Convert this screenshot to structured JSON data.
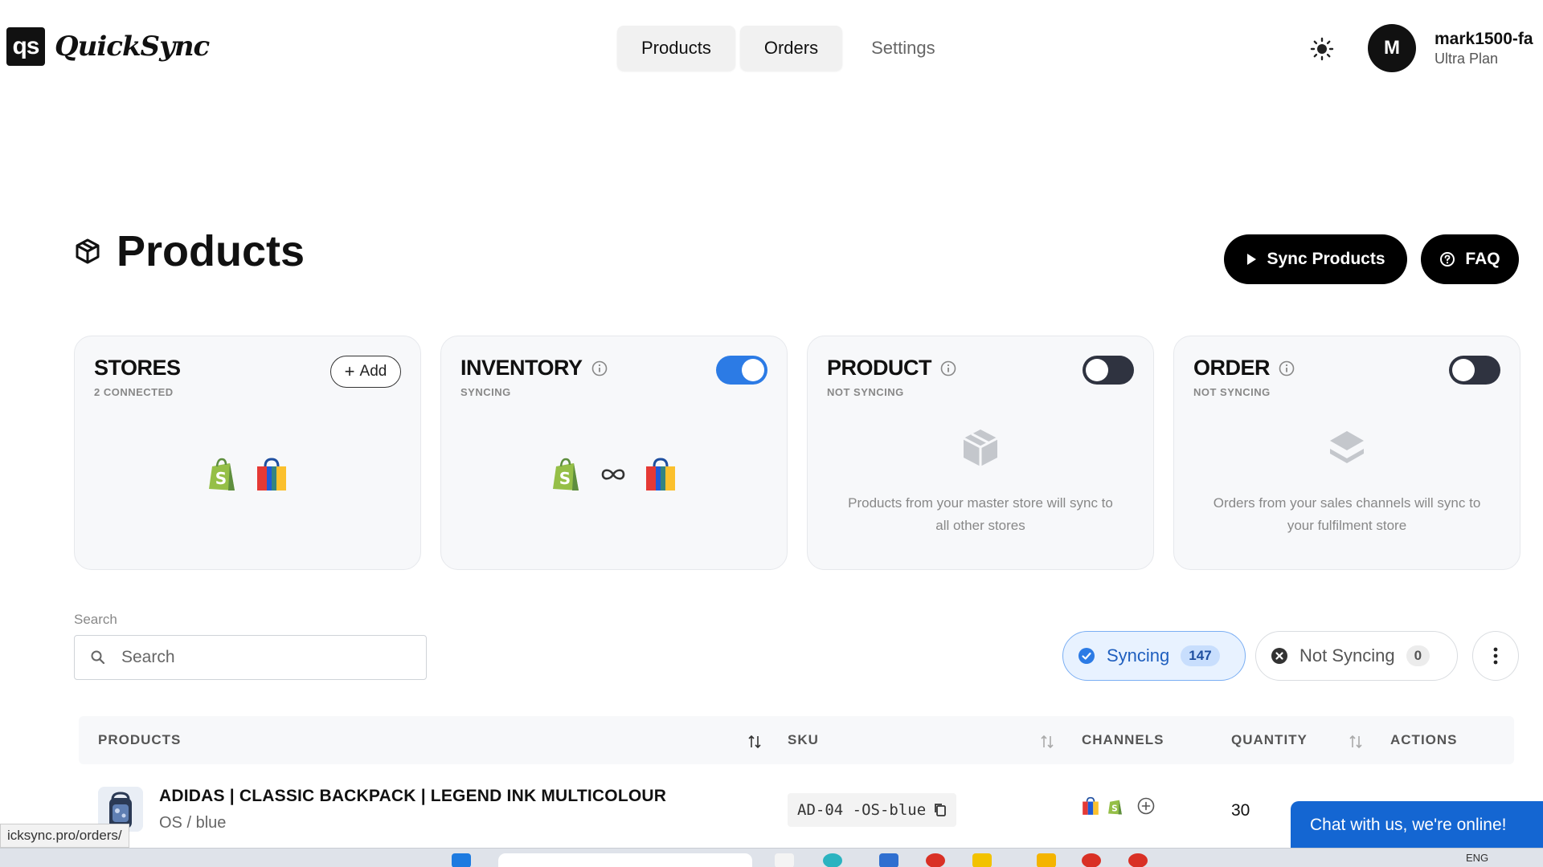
{
  "app": {
    "logo_mark": "qs",
    "logo_text": "QuickSync"
  },
  "nav": {
    "items": [
      {
        "label": "Products"
      },
      {
        "label": "Orders"
      },
      {
        "label": "Settings"
      }
    ]
  },
  "user": {
    "initial": "M",
    "name": "mark1500-fa",
    "plan": "Ultra Plan"
  },
  "page": {
    "title": "Products",
    "sync_button": "Sync Products",
    "faq_button": "FAQ"
  },
  "cards": {
    "stores": {
      "title": "STORES",
      "subtitle": "2 CONNECTED",
      "add_label": "Add"
    },
    "inventory": {
      "title": "INVENTORY",
      "subtitle": "SYNCING",
      "toggle_on": true
    },
    "product": {
      "title": "PRODUCT",
      "subtitle": "NOT SYNCING",
      "toggle_on": false,
      "description": "Products from your master store will sync to all other stores"
    },
    "order": {
      "title": "ORDER",
      "subtitle": "NOT SYNCING",
      "toggle_on": false,
      "description": "Orders from your sales channels will sync to your fulfilment store"
    }
  },
  "search": {
    "label": "Search",
    "placeholder": "Search",
    "value": ""
  },
  "filters": {
    "syncing": {
      "label": "Syncing",
      "count": "147"
    },
    "not_syncing": {
      "label": "Not Syncing",
      "count": "0"
    }
  },
  "table": {
    "headers": {
      "products": "PRODUCTS",
      "sku": "SKU",
      "channels": "CHANNELS",
      "quantity": "QUANTITY",
      "actions": "ACTIONS"
    },
    "rows": [
      {
        "name": "ADIDAS | CLASSIC BACKPACK | LEGEND INK MULTICOLOUR",
        "variant": "OS / blue",
        "sku": "AD-04 -OS-blue",
        "quantity": "30"
      }
    ]
  },
  "chat": {
    "label": "Chat with us, we're online!"
  },
  "status": {
    "url": "icksync.pro/orders/"
  },
  "taskbar": {
    "lang": "ENG"
  },
  "colors": {
    "accent": "#2c7be5",
    "shopify_green": "#95bf47",
    "dark": "#000000"
  }
}
